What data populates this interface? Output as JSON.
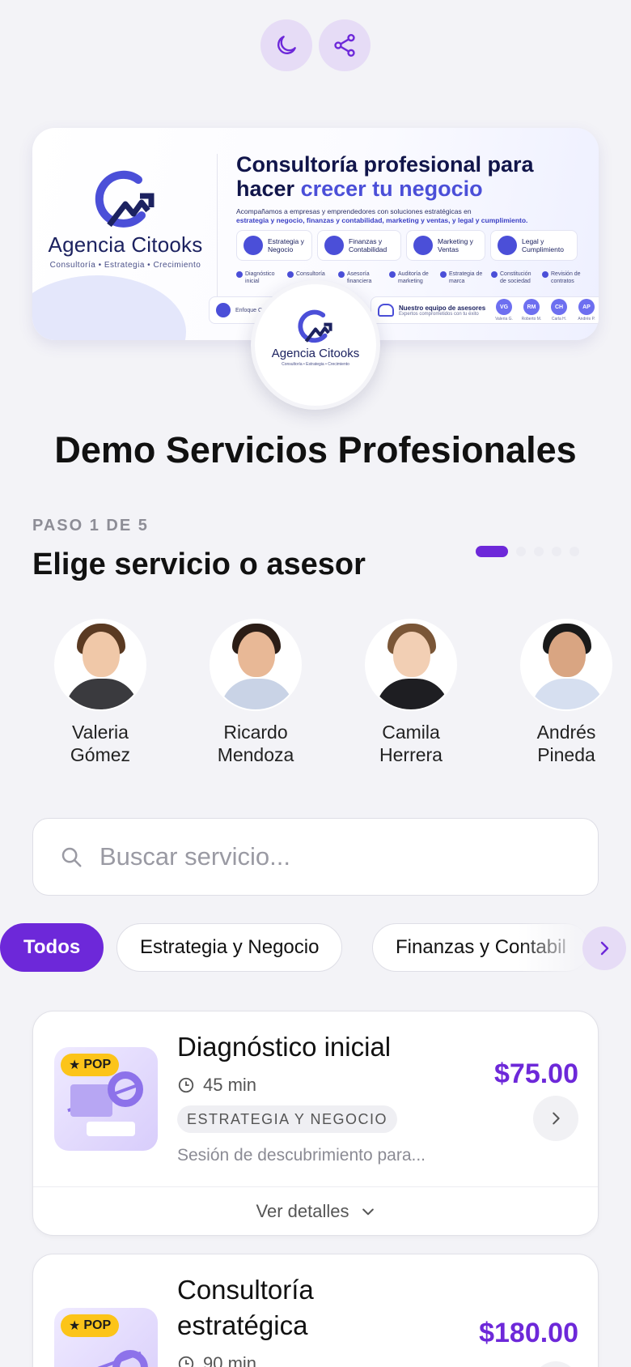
{
  "top_actions": {
    "theme_icon": "moon-icon",
    "share_icon": "share-icon"
  },
  "banner": {
    "brand_name": "Agencia Citooks",
    "brand_tagline": "Consultoría  •  Estrategia  •  Crecimiento",
    "headline_part1": "Consultoría profesional para",
    "headline_part2": "hacer ",
    "headline_highlight": "crecer tu negocio",
    "subtext_line1": "Acompañamos a empresas y emprendedores con soluciones estratégicas en",
    "subtext_line2": "estrategia y negocio, finanzas y contabilidad, marketing y ventas, y legal y cumplimiento.",
    "service_chips": [
      "Estrategia y Negocio",
      "Finanzas y Contabilidad",
      "Marketing y Ventas",
      "Legal y Cumplimiento"
    ],
    "checks": [
      "Diagnóstico inicial",
      "Consultoría",
      "Asesoría financiera",
      "Auditoría de marketing",
      "Estrategia de marca",
      "Constitución de sociedad",
      "Revisión de contratos"
    ],
    "foot_left": "Enfoque Confi...",
    "foot_right_title": "Nuestro equipo de asesores",
    "foot_right_sub": "Expertos comprometidos con tu éxito",
    "team_initials": [
      {
        "initials": "VG",
        "name": "Valeria G."
      },
      {
        "initials": "RM",
        "name": "Roberto M."
      },
      {
        "initials": "CH",
        "name": "Carla H."
      },
      {
        "initials": "AP",
        "name": "Andrés P."
      }
    ]
  },
  "center_logo": {
    "name": "Agencia Citooks",
    "tagline": "Consultoría • Estrategia • Crecimiento"
  },
  "page_title": "Demo Servicios Profesionales",
  "step": {
    "label": "PASO 1 DE 5",
    "title": "Elige servicio o asesor",
    "total": 5,
    "current": 1
  },
  "advisors": [
    {
      "first": "Valeria",
      "last": "Gómez"
    },
    {
      "first": "Ricardo",
      "last": "Mendoza"
    },
    {
      "first": "Camila",
      "last": "Herrera"
    },
    {
      "first": "Andrés",
      "last": "Pineda"
    }
  ],
  "search": {
    "placeholder": "Buscar servicio...",
    "value": ""
  },
  "filters": [
    "Todos",
    "Estrategia y Negocio",
    "Finanzas y Contabil"
  ],
  "services": [
    {
      "title": "Diagnóstico inicial",
      "badge": "POP",
      "duration": "45 min",
      "category": "ESTRATEGIA Y NEGOCIO",
      "description": "Sesión de descubrimiento para...",
      "price": "$75.00",
      "details_label": "Ver detalles"
    },
    {
      "title_line1": "Consultoría",
      "title_line2": "estratégica",
      "badge": "POP",
      "duration": "90 min",
      "price": "$180.00"
    }
  ],
  "colors": {
    "accent": "#6d28d9",
    "badge": "#fcc419",
    "background": "#f3f3f7",
    "brand_navy": "#1c2260"
  }
}
